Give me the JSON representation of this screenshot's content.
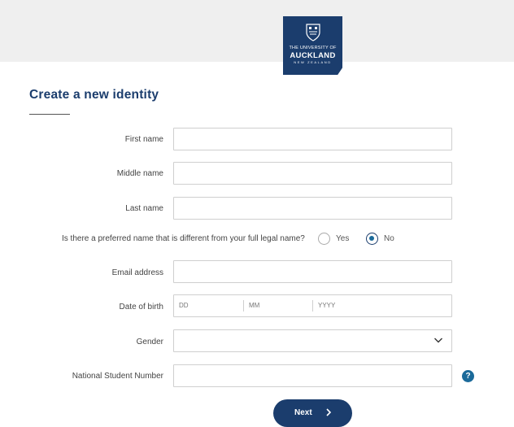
{
  "logo": {
    "line1": "THE UNIVERSITY OF",
    "line2": "AUCKLAND",
    "line3": "NEW ZEALAND"
  },
  "form": {
    "title": "Create a new identity",
    "first_name_label": "First name",
    "first_name_value": "",
    "middle_name_label": "Middle name",
    "middle_name_value": "",
    "last_name_label": "Last name",
    "last_name_value": "",
    "preferred_question": "Is there a preferred name that is different from your full legal name?",
    "preferred_yes": "Yes",
    "preferred_no": "No",
    "preferred_selected": "No",
    "email_label": "Email address",
    "email_value": "",
    "dob_label": "Date of birth",
    "dob_dd": "DD",
    "dob_mm": "MM",
    "dob_yyyy": "YYYY",
    "gender_label": "Gender",
    "gender_value": "",
    "nsn_label": "National Student Number",
    "nsn_value": "",
    "help_glyph": "?",
    "next_label": "Next"
  }
}
